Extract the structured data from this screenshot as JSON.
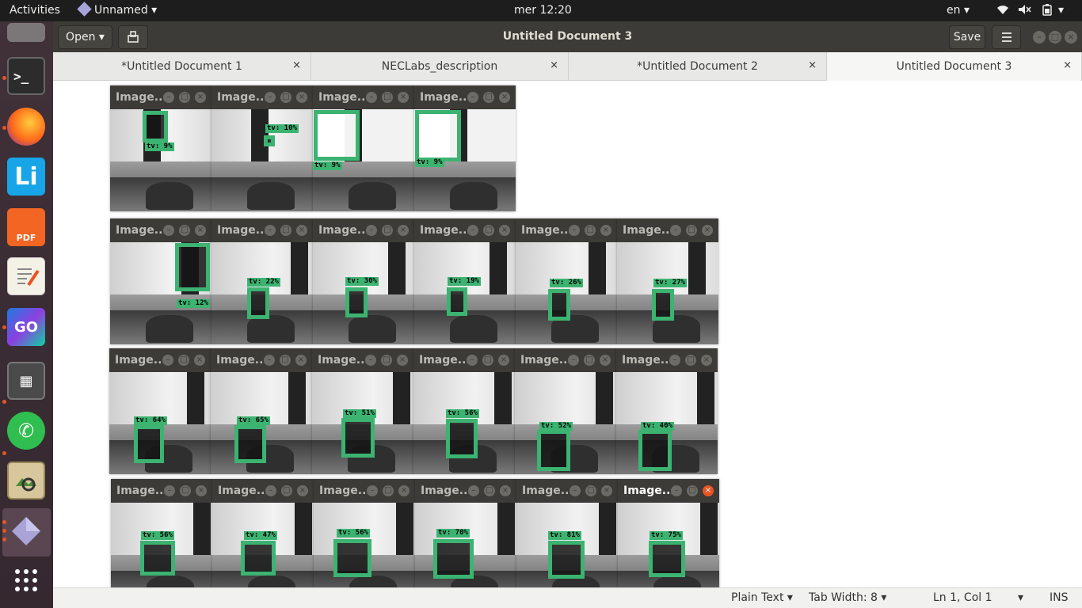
{
  "topbar": {
    "activities": "Activities",
    "app_menu": "Unnamed",
    "clock": "mer 12:20",
    "lang": "en"
  },
  "launcher": {
    "apps": [
      "Files",
      "Terminal",
      "Firefox",
      "LibreOffice",
      "Foxit PDF",
      "Text Editor",
      "GoLand",
      "Calculator",
      "WhatsApp",
      "Image Viewer",
      "Visual Studio Code",
      "Show Applications"
    ]
  },
  "header": {
    "open_label": "Open",
    "title": "Untitled Document 3",
    "save_label": "Save"
  },
  "tabs": [
    {
      "label": "*Untitled Document 1"
    },
    {
      "label": "NECLabs_description"
    },
    {
      "label": "*Untitled Document 2"
    },
    {
      "label": "Untitled Document 3"
    }
  ],
  "statusbar": {
    "language": "Plain Text",
    "tab_width": "Tab Width: 8",
    "position": "Ln 1, Col 1",
    "mode": "INS"
  },
  "image_windows": {
    "title": "Image...",
    "detections": [
      "tv: 9%",
      "tv: 10%",
      "tv: 9%",
      "tv: 9%",
      "tv: 12%",
      "tv: 22%",
      "tv: 30%",
      "tv: 19%",
      "tv: 26%",
      "tv: 27%",
      "tv: 64%",
      "tv: 65%",
      "tv: 51%",
      "tv: 56%",
      "tv: 52%",
      "tv: 40%",
      "tv: 56%",
      "tv: 47%",
      "tv: 56%",
      "tv: 70%",
      "tv: 81%",
      "tv: 75%"
    ]
  },
  "colors": {
    "detection_box": "#3cb371",
    "accent": "#e95420",
    "launcher_bg": "#3b2f36",
    "header_bg": "#3c3b37"
  }
}
